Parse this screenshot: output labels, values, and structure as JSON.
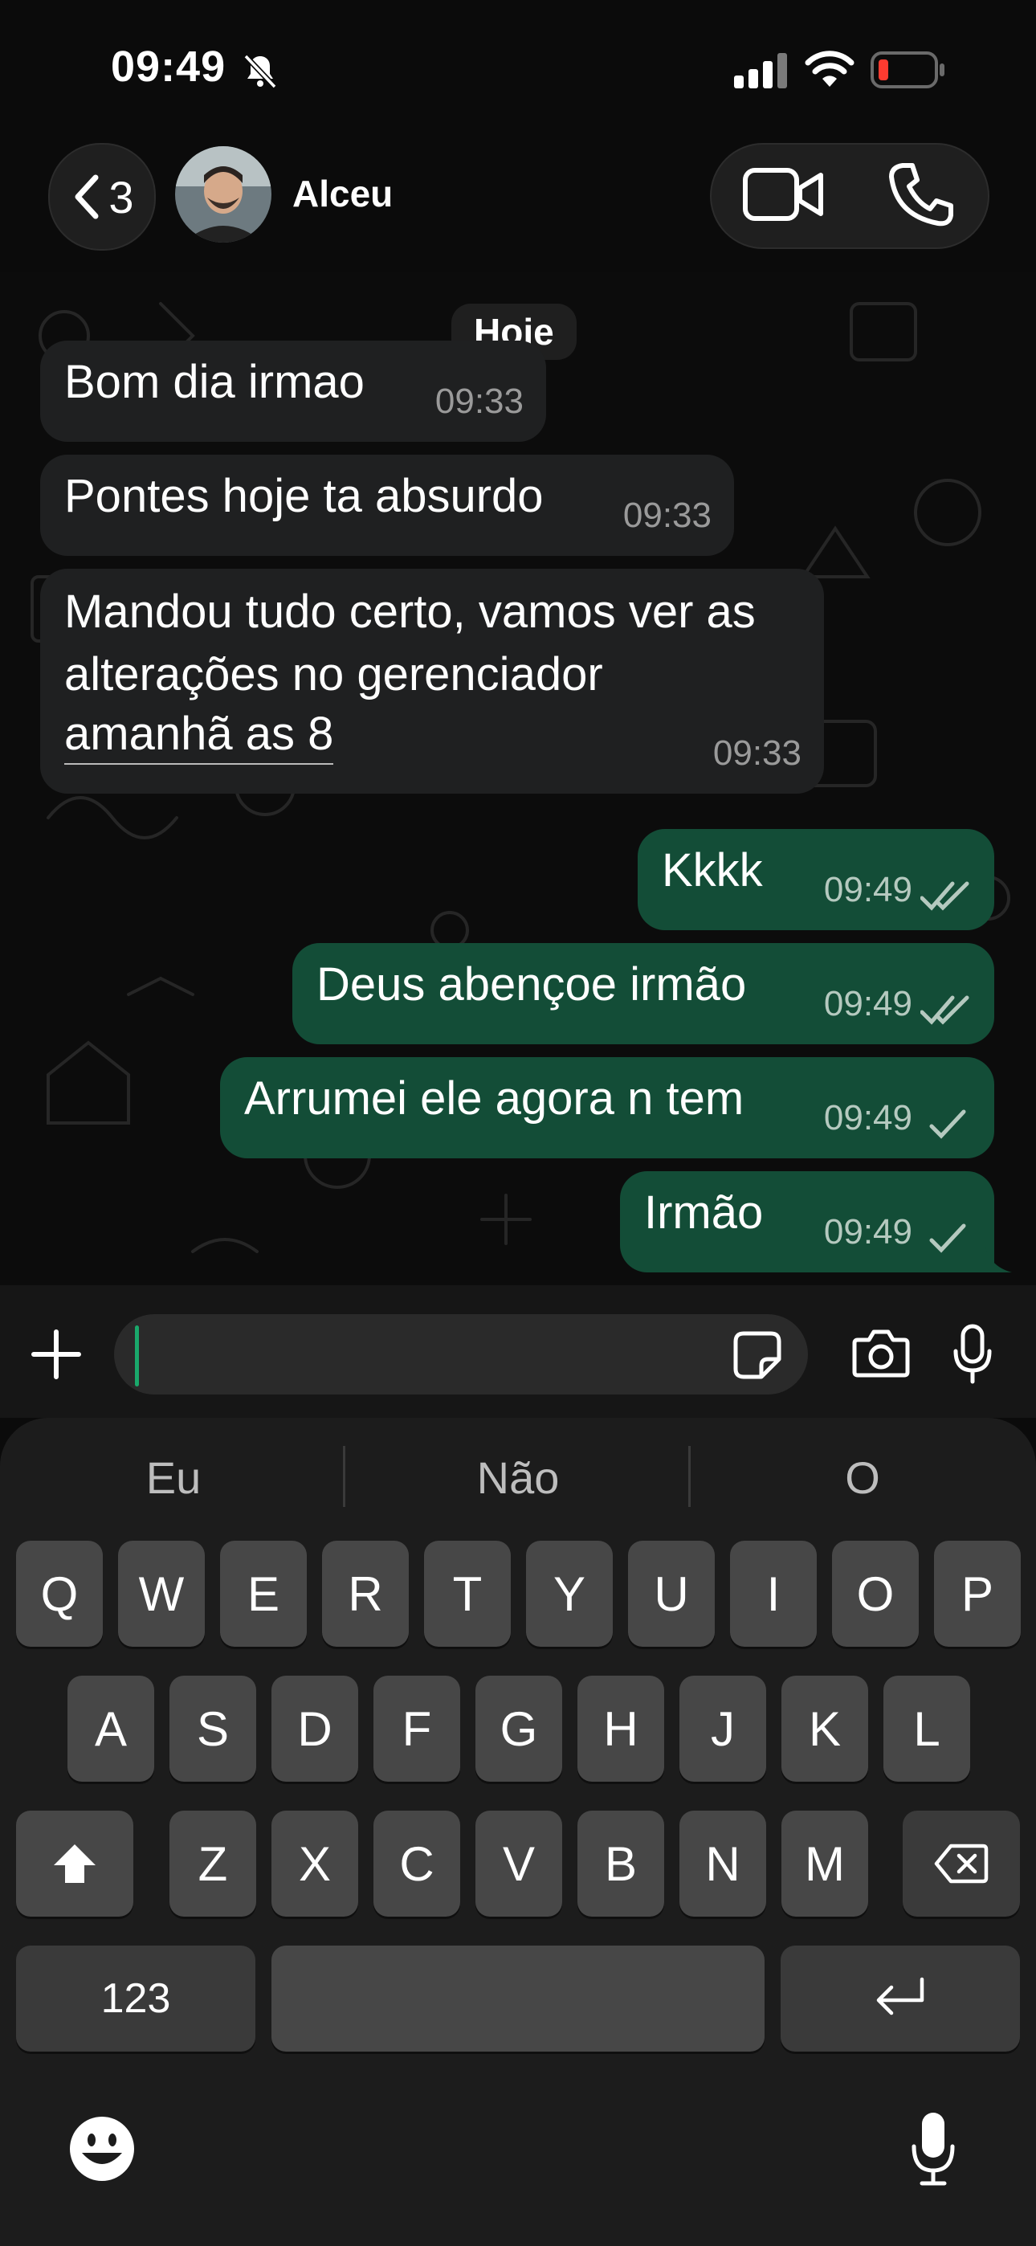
{
  "status_bar": {
    "time": "09:49"
  },
  "header": {
    "back_count": "3",
    "contact_name": "Alceu"
  },
  "date_chip": "Hoje",
  "messages": [
    {
      "text": "Bom dia irmao",
      "time": "09:33"
    },
    {
      "text": "Pontes hoje ta absurdo",
      "time": "09:33"
    },
    {
      "line1": "Mandou tudo certo, vamos ver as",
      "line2": "alterações no gerenciador",
      "line3": "amanhã as 8",
      "time": "09:33"
    },
    {
      "text": "Kkkk",
      "time": "09:49",
      "status": "read"
    },
    {
      "text": "Deus abençoe irmão",
      "time": "09:49",
      "status": "read"
    },
    {
      "text": "Arrumei ele agora n tem",
      "time": "09:49",
      "status": "sent"
    },
    {
      "text": "Irmão",
      "time": "09:49",
      "status": "sent"
    }
  ],
  "keyboard": {
    "suggestions": [
      "Eu",
      "Não",
      "O"
    ],
    "row1": [
      "Q",
      "W",
      "E",
      "R",
      "T",
      "Y",
      "U",
      "I",
      "O",
      "P"
    ],
    "row2": [
      "A",
      "S",
      "D",
      "F",
      "G",
      "H",
      "J",
      "K",
      "L"
    ],
    "row3": [
      "Z",
      "X",
      "C",
      "V",
      "B",
      "N",
      "M"
    ],
    "numbers_key": "123"
  }
}
